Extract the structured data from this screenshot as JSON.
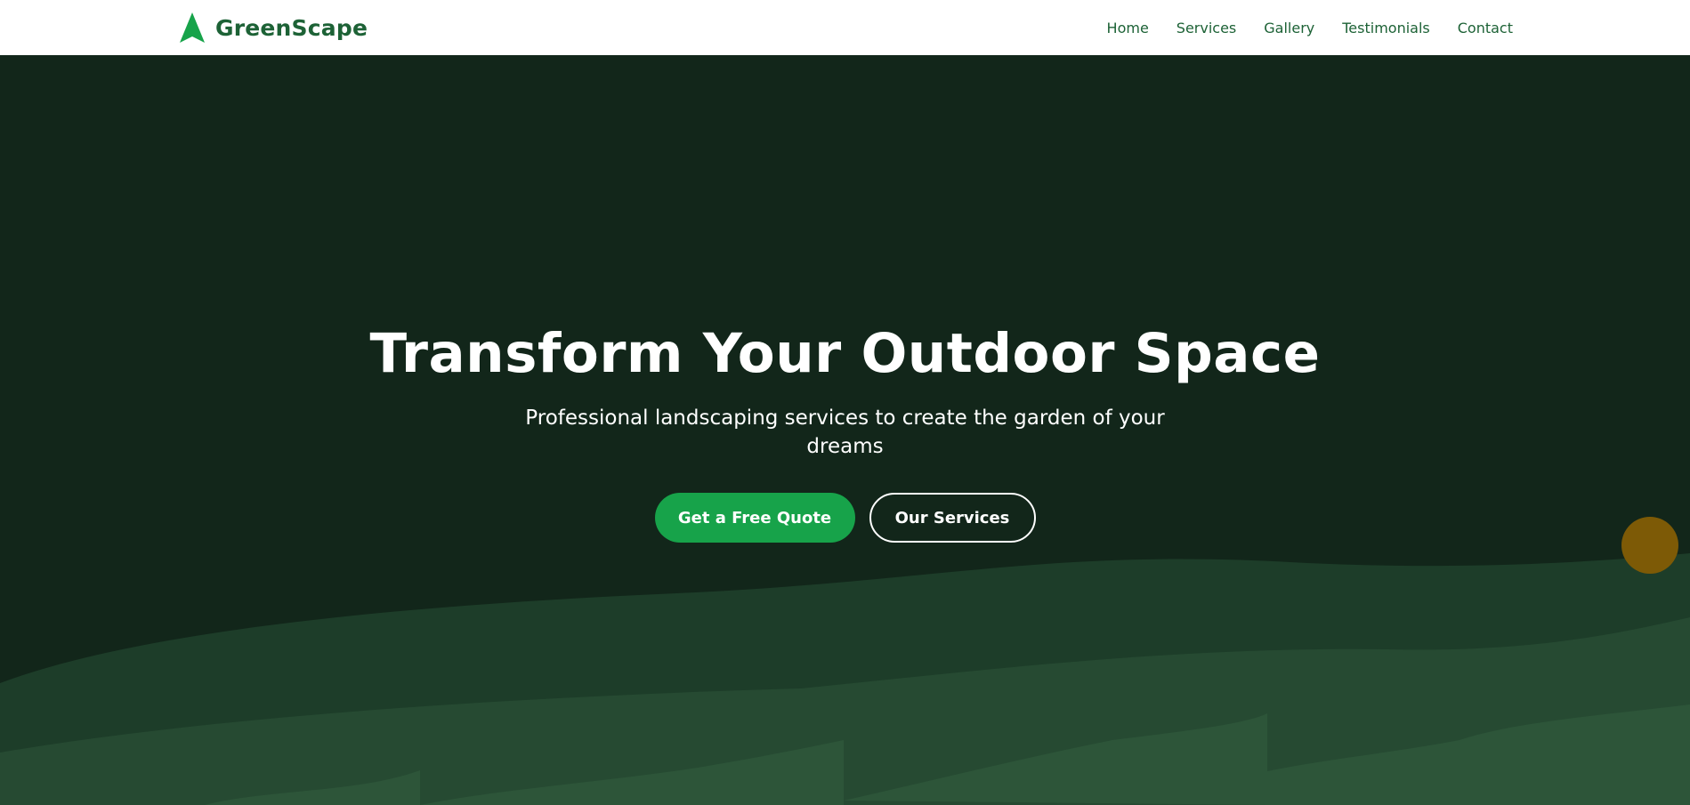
{
  "brand": {
    "name": "GreenScape",
    "logo_icon": "tree-icon",
    "accent_color": "#17a34a",
    "brand_color": "#1d6236"
  },
  "nav": {
    "items": [
      {
        "label": "Home"
      },
      {
        "label": "Services"
      },
      {
        "label": "Gallery"
      },
      {
        "label": "Testimonials"
      },
      {
        "label": "Contact"
      }
    ]
  },
  "hero": {
    "title": "Transform Your Outdoor Space",
    "subtitle": "Professional landscaping services to create the garden of your dreams",
    "primary_button": "Get a Free Quote",
    "secondary_button": "Our Services",
    "background_color": "#12261a",
    "wave_colors": [
      "#1d3d29",
      "#264a32",
      "#2d5539"
    ],
    "sun_color": "#7d5a06"
  }
}
